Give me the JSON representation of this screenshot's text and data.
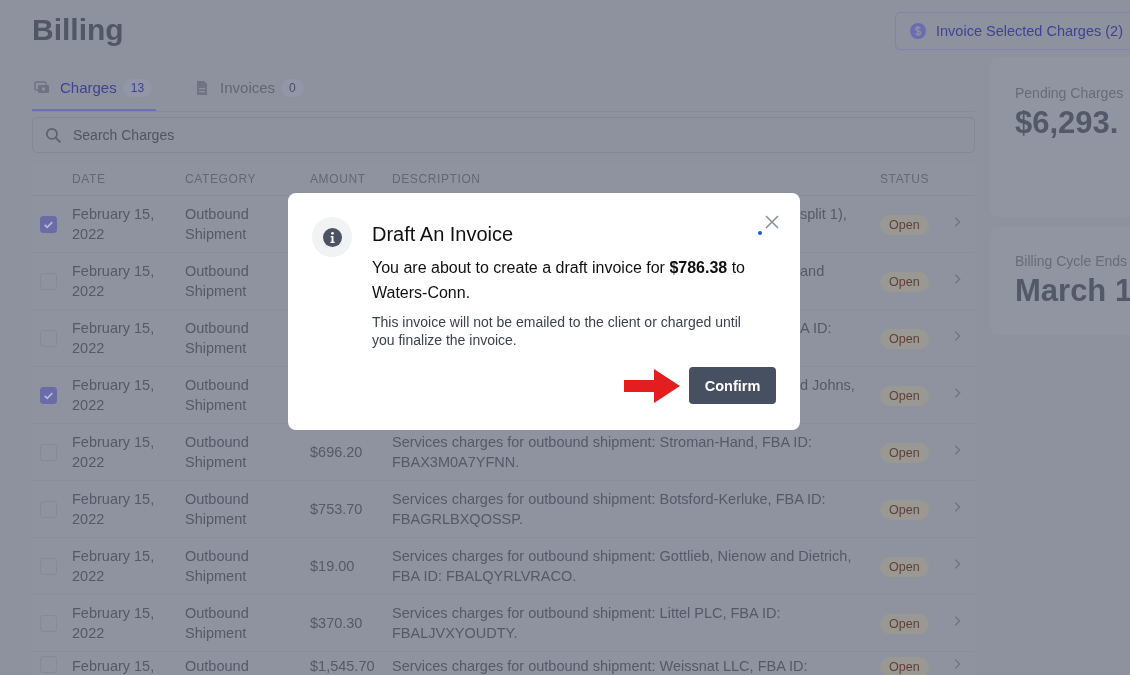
{
  "page": {
    "title": "Billing",
    "invoice_button": "Invoice Selected Charges (2)"
  },
  "tabs": [
    {
      "label": "Charges",
      "count": "13",
      "selected": true,
      "kind": "charges"
    },
    {
      "label": "Invoices",
      "count": "0",
      "selected": false,
      "kind": "invoices"
    }
  ],
  "search": {
    "placeholder": "Search Charges"
  },
  "table": {
    "columns": [
      "DATE",
      "CATEGORY",
      "AMOUNT",
      "DESCRIPTION",
      "STATUS"
    ],
    "rows": [
      {
        "kind": "covered",
        "checked": true,
        "date": "February 15, 2022",
        "category": "Outbound Shipment",
        "description": "split 1),",
        "status": "Open"
      },
      {
        "kind": "covered",
        "checked": false,
        "date": "February 15, 2022",
        "category": "Outbound Shipment",
        "description": "and",
        "status": "Open"
      },
      {
        "kind": "covered",
        "checked": false,
        "date": "February 15, 2022",
        "category": "Outbound Shipment",
        "description": "A ID:",
        "status": "Open"
      },
      {
        "kind": "covered",
        "checked": true,
        "date": "February 15, 2022",
        "category": "Outbound Shipment",
        "description": "d Johns,",
        "status": "Open"
      },
      {
        "kind": "full",
        "checked": false,
        "date": "February 15, 2022",
        "category": "Outbound Shipment",
        "amount": "$696.20",
        "description": "Services charges for outbound shipment: Stroman-Hand, FBA ID: FBAX3M0A7YFNN.",
        "status": "Open"
      },
      {
        "kind": "full",
        "checked": false,
        "date": "February 15, 2022",
        "category": "Outbound Shipment",
        "amount": "$753.70",
        "description": "Services charges for outbound shipment: Botsford-Kerluke, FBA ID: FBAGRLBXQOSSP.",
        "status": "Open"
      },
      {
        "kind": "full",
        "checked": false,
        "date": "February 15, 2022",
        "category": "Outbound Shipment",
        "amount": "$19.00",
        "description": "Services charges for outbound shipment: Gottlieb, Nienow and Dietrich, FBA ID: FBALQYRLVRACO.",
        "status": "Open"
      },
      {
        "kind": "full",
        "checked": false,
        "date": "February 15, 2022",
        "category": "Outbound Shipment",
        "amount": "$370.30",
        "description": "Services charges for outbound shipment: Littel PLC, FBA ID: FBALJVXYOUDTY.",
        "status": "Open"
      },
      {
        "kind": "cut",
        "checked": false,
        "date": "February 15,",
        "category": "Outbound",
        "amount": "$1,545.70",
        "description": "Services charges for outbound shipment: Weissnat LLC, FBA ID:",
        "status": "Open"
      }
    ]
  },
  "cards": [
    {
      "label": "Pending Charges",
      "value": "$6,293."
    },
    {
      "label": "Billing Cycle Ends",
      "value": "March 1"
    }
  ],
  "modal": {
    "title": "Draft An Invoice",
    "body": "You are about to create a draft invoice for **$786.38** to Waters-Conn.",
    "note": "This invoice will not be emailed to the client or charged until you finalize the invoice.",
    "confirm": "Confirm"
  }
}
